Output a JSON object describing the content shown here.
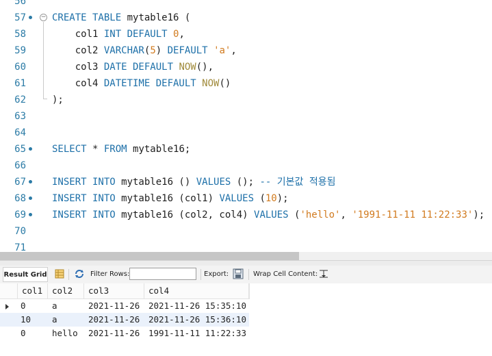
{
  "editor": {
    "lines": [
      {
        "num": "56",
        "html": ""
      },
      {
        "num": "57",
        "dot": true,
        "fold": "⊖",
        "html": "<span class='kw'>CREATE TABLE</span> mytable16 ("
      },
      {
        "num": "58",
        "html": "    col1 <span class='kw'>INT DEFAULT</span> <span class='num'>0</span>,"
      },
      {
        "num": "59",
        "html": "    col2 <span class='kw'>VARCHAR</span>(<span class='num'>5</span>) <span class='kw'>DEFAULT</span> <span class='str'>'a'</span>,"
      },
      {
        "num": "60",
        "html": "    col3 <span class='kw'>DATE DEFAULT</span> <span class='fn'>NOW</span>(),"
      },
      {
        "num": "61",
        "html": "    col4 <span class='kw'>DATETIME DEFAULT</span> <span class='fn'>NOW</span>()"
      },
      {
        "num": "62",
        "html": ");"
      },
      {
        "num": "63",
        "html": ""
      },
      {
        "num": "64",
        "html": ""
      },
      {
        "num": "65",
        "dot": true,
        "html": "<span class='kw'>SELECT</span> * <span class='kw'>FROM</span> mytable16;"
      },
      {
        "num": "66",
        "html": ""
      },
      {
        "num": "67",
        "dot": true,
        "html": "<span class='kw'>INSERT INTO</span> mytable16 () <span class='kw'>VALUES</span> (); <span class='cm'>-- 기본값 적용됨</span>"
      },
      {
        "num": "68",
        "dot": true,
        "html": "<span class='kw'>INSERT INTO</span> mytable16 (col1) <span class='kw'>VALUES</span> (<span class='num'>10</span>);"
      },
      {
        "num": "69",
        "dot": true,
        "html": "<span class='kw'>INSERT INTO</span> mytable16 (col2, col4) <span class='kw'>VALUES</span> (<span class='str'>'hello'</span>, <span class='str'>'1991-11-11 11:22:33'</span>);"
      },
      {
        "num": "70",
        "html": ""
      },
      {
        "num": "71",
        "html": ""
      }
    ]
  },
  "toolbar": {
    "result_grid_label": "Result Grid",
    "filter_rows_label": "Filter Rows:",
    "filter_value": "",
    "export_label": "Export:",
    "wrap_label": "Wrap Cell Content:"
  },
  "grid": {
    "columns": [
      "col1",
      "col2",
      "col3",
      "col4"
    ],
    "rows": [
      [
        "0",
        "a",
        "2021-11-26",
        "2021-11-26 15:35:10"
      ],
      [
        "10",
        "a",
        "2021-11-26",
        "2021-11-26 15:36:10"
      ],
      [
        "0",
        "hello",
        "2021-11-26",
        "1991-11-11 11:22:33"
      ]
    ]
  }
}
